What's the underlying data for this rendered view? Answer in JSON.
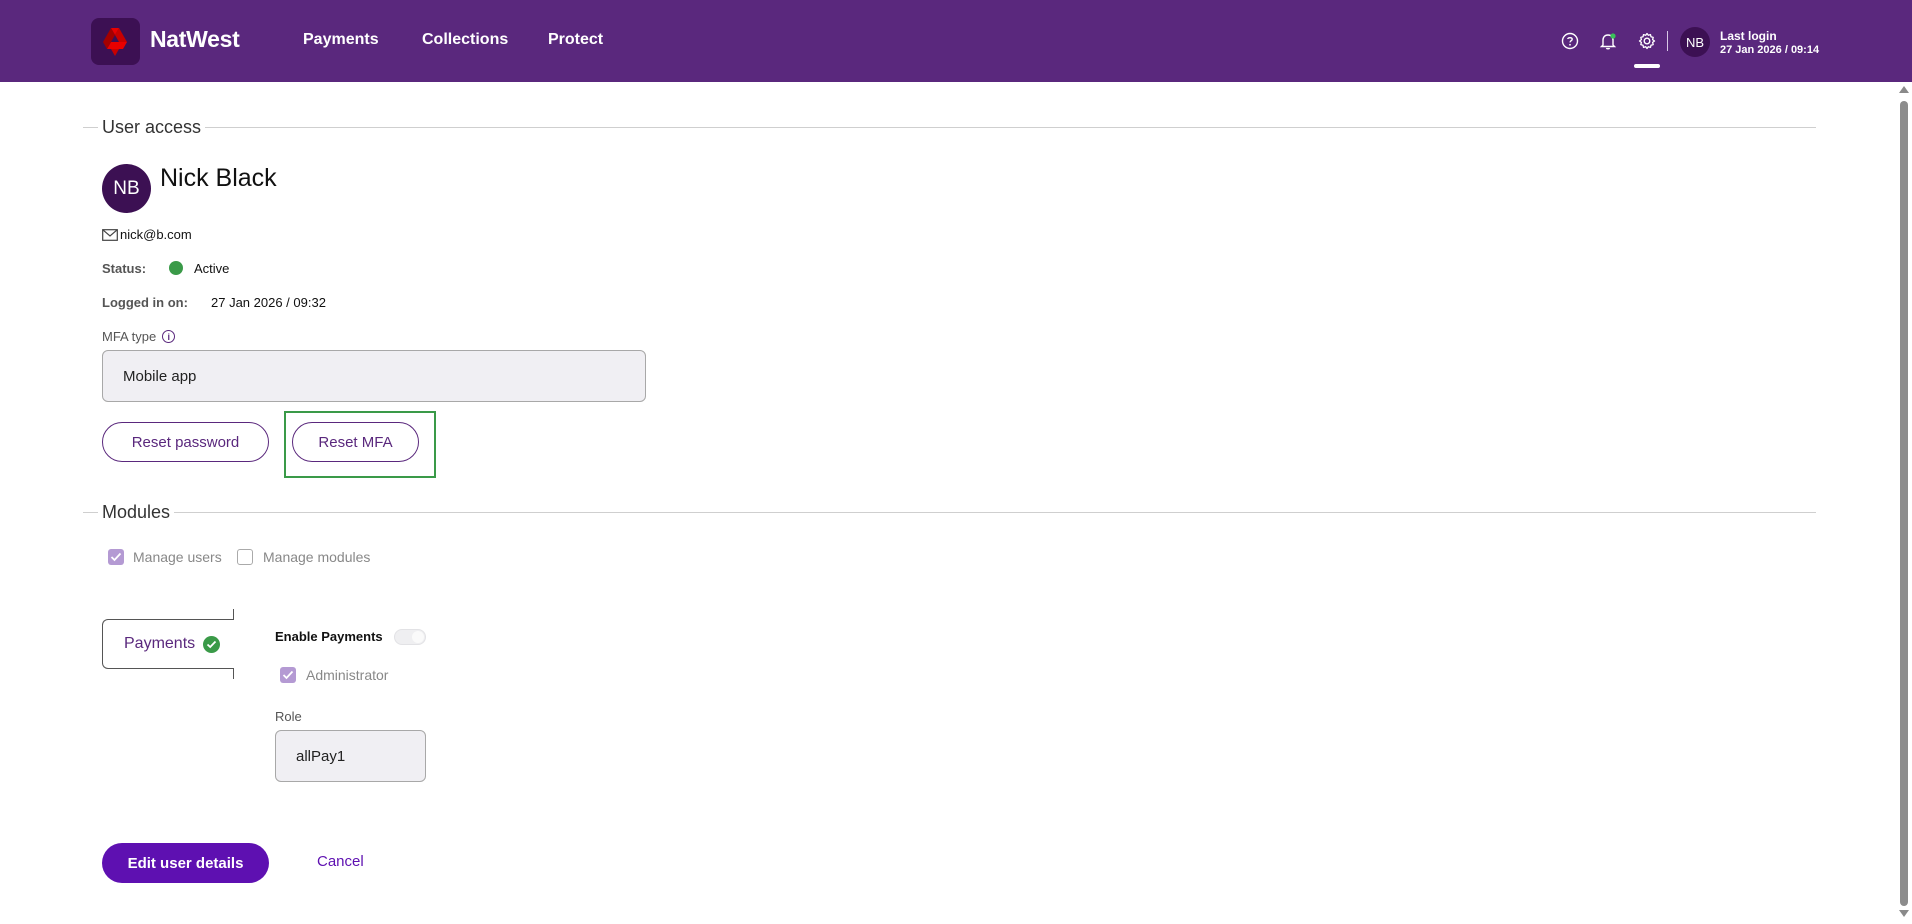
{
  "header": {
    "brand": "NatWest",
    "nav": [
      "Payments",
      "Collections",
      "Protect"
    ],
    "avatar_initials": "NB",
    "last_login_title": "Last login",
    "last_login_value": "27 Jan 2026 / 09:14"
  },
  "user_access": {
    "section_title": "User access",
    "avatar_initials": "NB",
    "name": "Nick Black",
    "email": "nick@b.com",
    "status_label": "Status:",
    "status_value": "Active",
    "logged_in_label": "Logged in on:",
    "logged_in_value": "27 Jan 2026 / 09:32",
    "mfa_label": "MFA type",
    "mfa_value": "Mobile app",
    "reset_password_label": "Reset password",
    "reset_mfa_label": "Reset MFA"
  },
  "modules": {
    "section_title": "Modules",
    "checkboxes": [
      {
        "label": "Manage users",
        "checked": true
      },
      {
        "label": "Manage modules",
        "checked": false
      }
    ],
    "tab_label": "Payments",
    "enable_label": "Enable Payments",
    "enable_on": false,
    "administrator_label": "Administrator",
    "administrator_checked": true,
    "role_label": "Role",
    "role_value": "allPay1"
  },
  "footer": {
    "edit_label": "Edit user details",
    "cancel_label": "Cancel"
  },
  "colors": {
    "header_bg": "#5a287d",
    "primary": "#5e10b1",
    "success": "#3a9a48"
  }
}
